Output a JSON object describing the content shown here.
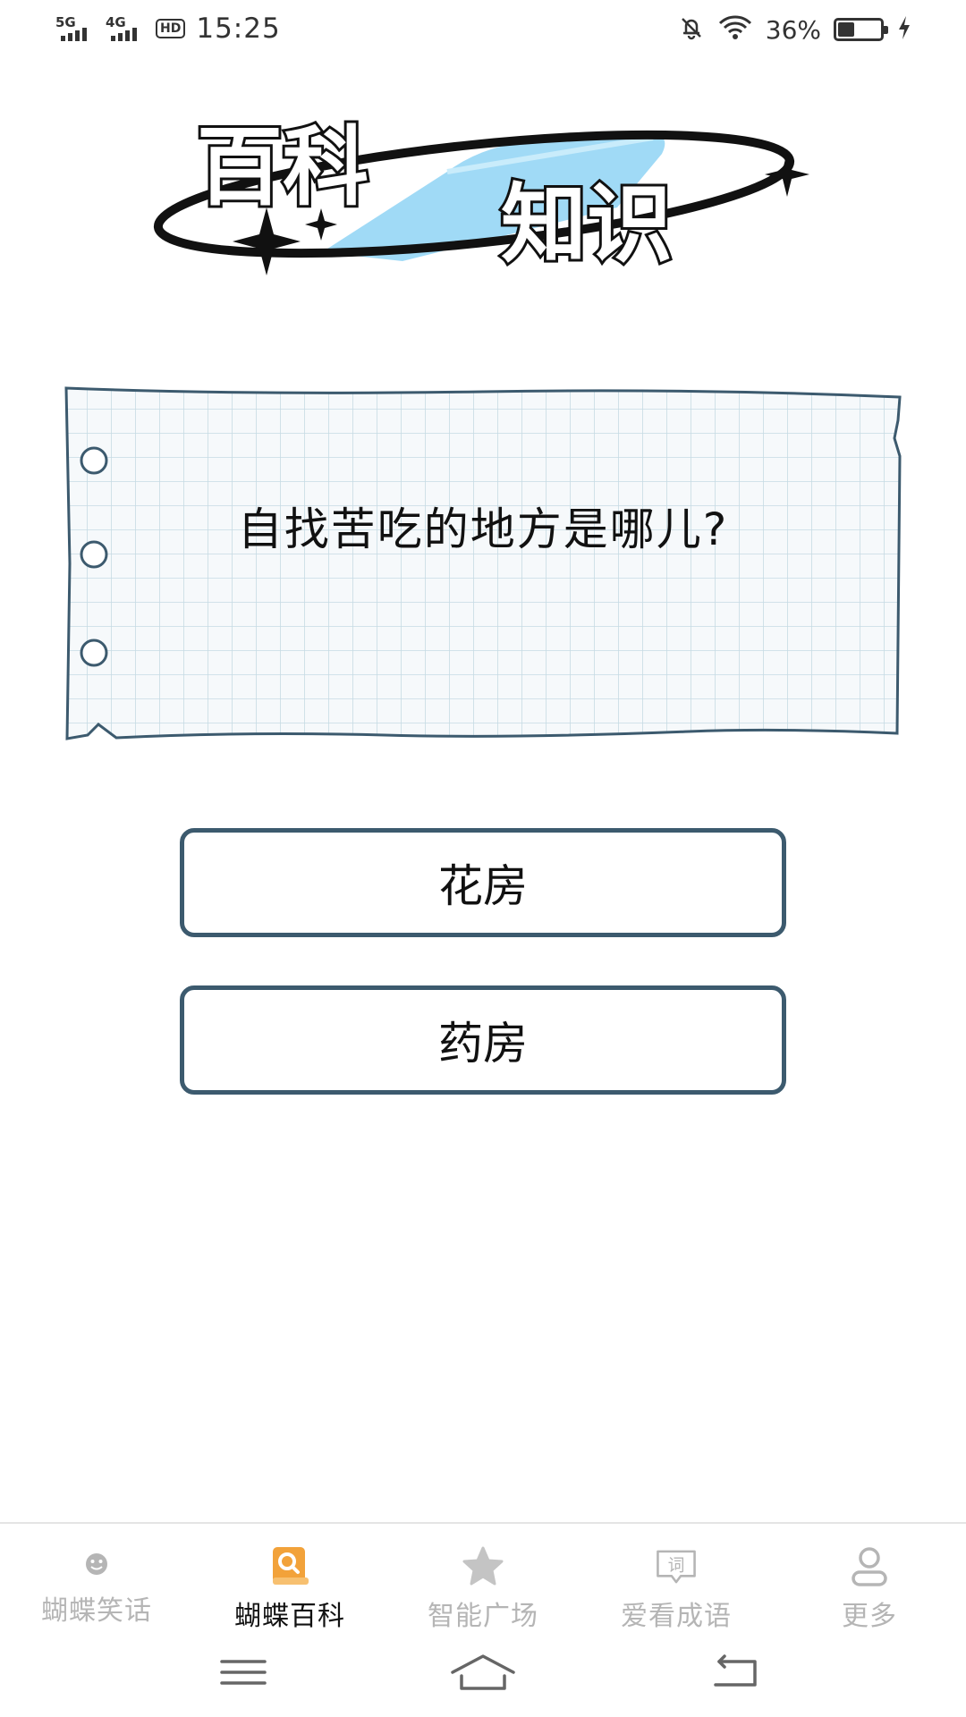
{
  "status_bar": {
    "signal1_label": "5G",
    "signal2_label": "4G",
    "hd_label": "HD",
    "time": "15:25",
    "battery_percent_text": "36%",
    "battery_level": 0.36,
    "icons": [
      "mute-bell-icon",
      "wifi-icon",
      "battery-icon",
      "charging-icon"
    ]
  },
  "header": {
    "title_line1": "百科",
    "title_line2": "知识",
    "accent_color": "#8fd3f4"
  },
  "question": {
    "text": "自找苦吃的地方是哪儿?"
  },
  "options": [
    {
      "label": "花房"
    },
    {
      "label": "药房"
    }
  ],
  "colors": {
    "option_border": "#3c5a6e",
    "inactive_tab": "#b5b5b5",
    "active_tab_icon": "#f2a23a"
  },
  "bottom_nav": {
    "items": [
      {
        "label": "蝴蝶笑话",
        "icon": "smiley-icon",
        "active": false
      },
      {
        "label": "蝴蝶百科",
        "icon": "book-search-icon",
        "active": true
      },
      {
        "label": "智能广场",
        "icon": "star-icon",
        "active": false
      },
      {
        "label": "爱看成语",
        "icon": "idiom-chat-icon",
        "active": false,
        "icon_text": "词"
      },
      {
        "label": "更多",
        "icon": "person-icon",
        "active": false
      }
    ]
  },
  "system_nav": {
    "icons": [
      "menu-icon",
      "home-icon",
      "back-icon"
    ]
  }
}
